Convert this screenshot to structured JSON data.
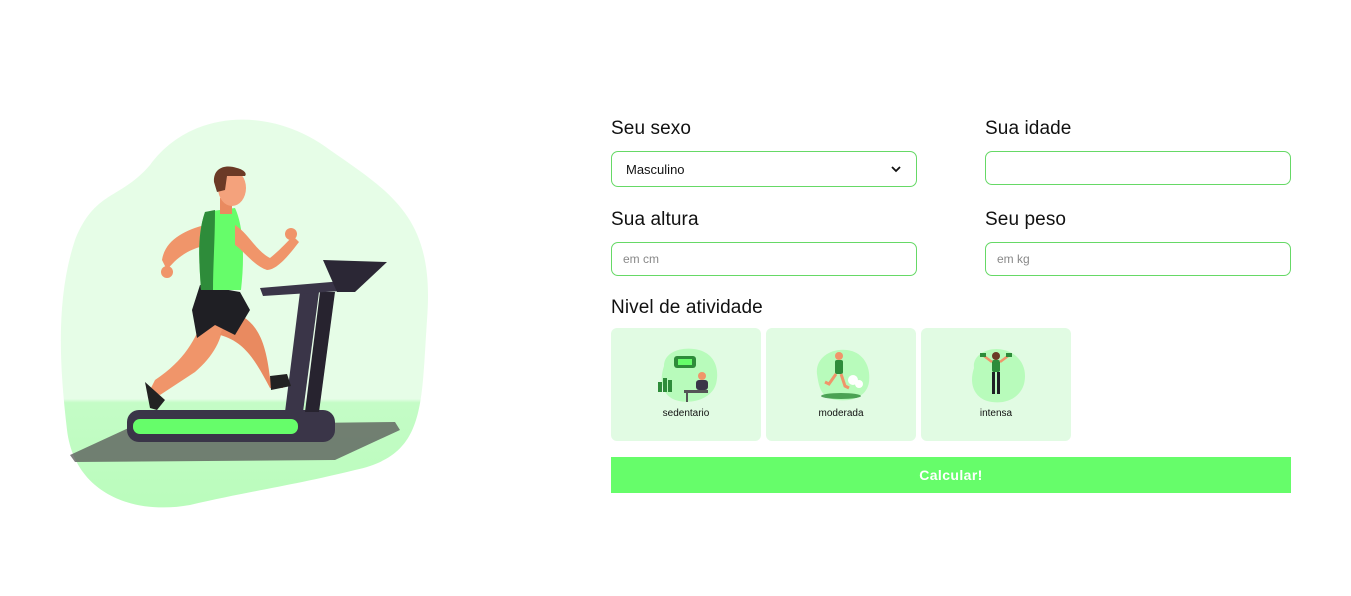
{
  "form": {
    "sex": {
      "label": "Seu sexo",
      "value": "Masculino"
    },
    "age": {
      "label": "Sua idade",
      "value": ""
    },
    "height": {
      "label": "Sua altura",
      "placeholder": "em cm"
    },
    "weight": {
      "label": "Seu peso",
      "placeholder": "em kg"
    },
    "activity_label": "Nivel de atividade",
    "activities": [
      {
        "name": "sedentario",
        "icon": "sedentary-person-icon"
      },
      {
        "name": "moderada",
        "icon": "running-person-icon"
      },
      {
        "name": "intensa",
        "icon": "workout-person-icon"
      }
    ],
    "submit_label": "Calcular!"
  },
  "colors": {
    "accent": "#66fd6a",
    "field_border": "#66d966",
    "card_bg": "#e1fbe3"
  }
}
